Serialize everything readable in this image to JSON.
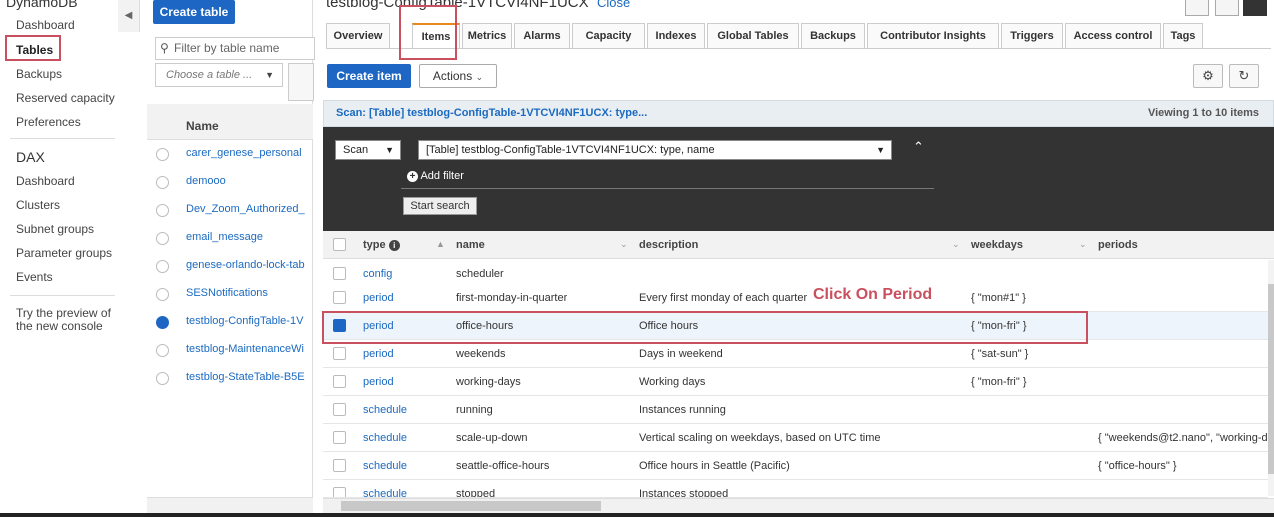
{
  "left_nav": {
    "title": "DynamoDB",
    "items": [
      "Dashboard",
      "Tables",
      "Backups",
      "Reserved capacity",
      "Preferences"
    ],
    "dax_title": "DAX",
    "dax_items": [
      "Dashboard",
      "Clusters",
      "Subnet groups",
      "Parameter groups",
      "Events"
    ],
    "preview_note": "Try the preview of the new console"
  },
  "table_list": {
    "create_button": "Create table",
    "filter_placeholder": "Filter by table name",
    "choose_placeholder": "Choose a table ...",
    "column_header": "Name",
    "rows": [
      "carer_genese_personal",
      "demooo",
      "Dev_Zoom_Authorized_",
      "email_message",
      "genese-orlando-lock-tab",
      "SESNotifications",
      "testblog-ConfigTable-1V",
      "testblog-MaintenanceWi",
      "testblog-StateTable-B5E"
    ],
    "selected_index": 6
  },
  "main": {
    "table_title": "testblog-ConfigTable-1VTCVI4NF1UCX",
    "close_link": "Close",
    "tabs": [
      "Overview",
      "Items",
      "Metrics",
      "Alarms",
      "Capacity",
      "Indexes",
      "Global Tables",
      "Backups",
      "Contributor Insights",
      "Triggers",
      "Access control",
      "Tags"
    ],
    "active_tab": "Items",
    "create_item": "Create item",
    "actions": "Actions",
    "scan_summary": "Scan: [Table] testblog-ConfigTable-1VTCVI4NF1UCX: type...",
    "viewing": "Viewing 1 to 10 items",
    "scan_mode": "Scan",
    "scan_source": "[Table] testblog-ConfigTable-1VTCVI4NF1UCX: type, name",
    "add_filter": "Add filter",
    "start_search": "Start search",
    "columns": {
      "type": "type",
      "name": "name",
      "description": "description",
      "weekdays": "weekdays",
      "periods": "periods"
    },
    "rows": [
      {
        "type": "config",
        "name": "scheduler",
        "description": "",
        "weekdays": "",
        "periods": ""
      },
      {
        "type": "period",
        "name": "first-monday-in-quarter",
        "description": "Every first monday of each quarter",
        "weekdays": "{ \"mon#1\" }",
        "periods": ""
      },
      {
        "type": "period",
        "name": "office-hours",
        "description": "Office hours",
        "weekdays": "{ \"mon-fri\" }",
        "periods": ""
      },
      {
        "type": "period",
        "name": "weekends",
        "description": "Days in weekend",
        "weekdays": "{ \"sat-sun\" }",
        "periods": ""
      },
      {
        "type": "period",
        "name": "working-days",
        "description": "Working days",
        "weekdays": "{ \"mon-fri\" }",
        "periods": ""
      },
      {
        "type": "schedule",
        "name": "running",
        "description": "Instances running",
        "weekdays": "",
        "periods": ""
      },
      {
        "type": "schedule",
        "name": "scale-up-down",
        "description": "Vertical scaling on weekdays, based on UTC time",
        "weekdays": "",
        "periods": "{ \"weekends@t2.nano\", \"working-d"
      },
      {
        "type": "schedule",
        "name": "seattle-office-hours",
        "description": "Office hours in Seattle (Pacific)",
        "weekdays": "",
        "periods": "{ \"office-hours\" }"
      },
      {
        "type": "schedule",
        "name": "stopped",
        "description": "Instances stopped",
        "weekdays": "",
        "periods": ""
      }
    ],
    "selected_row": 2
  },
  "annotation": {
    "click_note": "Click On Period",
    "color": "#c9505e"
  },
  "colors": {
    "primary_button": "#1e66c4",
    "link": "#1b6ac1",
    "active_tab_accent": "#e8871e",
    "dark_panel": "#333333"
  }
}
